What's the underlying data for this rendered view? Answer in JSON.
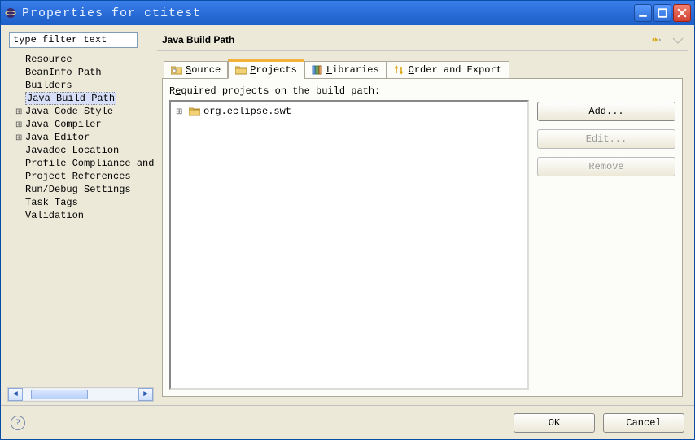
{
  "window": {
    "title": "Properties for ctitest"
  },
  "sidebar": {
    "filter_placeholder": "type filter text",
    "items": [
      {
        "label": "Resource",
        "children": false,
        "selected": false
      },
      {
        "label": "BeanInfo Path",
        "children": false,
        "selected": false
      },
      {
        "label": "Builders",
        "children": false,
        "selected": false
      },
      {
        "label": "Java Build Path",
        "children": false,
        "selected": true
      },
      {
        "label": "Java Code Style",
        "children": true,
        "selected": false
      },
      {
        "label": "Java Compiler",
        "children": true,
        "selected": false
      },
      {
        "label": "Java Editor",
        "children": true,
        "selected": false
      },
      {
        "label": "Javadoc Location",
        "children": false,
        "selected": false
      },
      {
        "label": "Profile Compliance and",
        "children": false,
        "selected": false
      },
      {
        "label": "Project References",
        "children": false,
        "selected": false
      },
      {
        "label": "Run/Debug Settings",
        "children": false,
        "selected": false
      },
      {
        "label": "Task Tags",
        "children": false,
        "selected": false
      },
      {
        "label": "Validation",
        "children": false,
        "selected": false
      }
    ]
  },
  "page": {
    "title": "Java Build Path",
    "tabs": [
      {
        "label": "Source",
        "icon": "source-folder-icon"
      },
      {
        "label": "Projects",
        "icon": "projects-folder-icon"
      },
      {
        "label": "Libraries",
        "icon": "library-icon"
      },
      {
        "label": "Order and Export",
        "icon": "order-icon"
      }
    ],
    "active_tab": 1,
    "required_label_pre": "R",
    "required_label_u": "e",
    "required_label_post": "quired projects on the build path:",
    "projects": [
      {
        "label": "org.eclipse.swt"
      }
    ],
    "buttons": {
      "add_pre": "",
      "add_u": "A",
      "add_post": "dd...",
      "edit": "Edit...",
      "remove": "Remove"
    }
  },
  "footer": {
    "ok": "OK",
    "cancel": "Cancel"
  }
}
